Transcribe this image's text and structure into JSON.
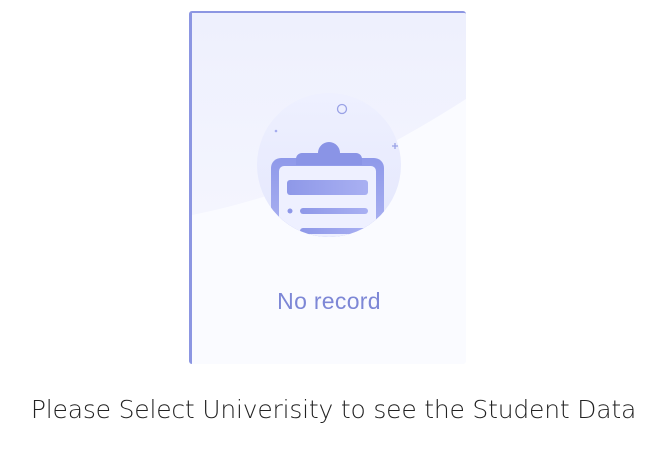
{
  "empty_state": {
    "icon": "clipboard-icon",
    "label": "No record"
  },
  "prompt": {
    "message": "Please Select Univerisity to see the Student Data"
  },
  "colors": {
    "accent": "#8c96e2",
    "card_background": "#fafbff",
    "illustration_circle": "#eceeff",
    "text": "#222222"
  }
}
